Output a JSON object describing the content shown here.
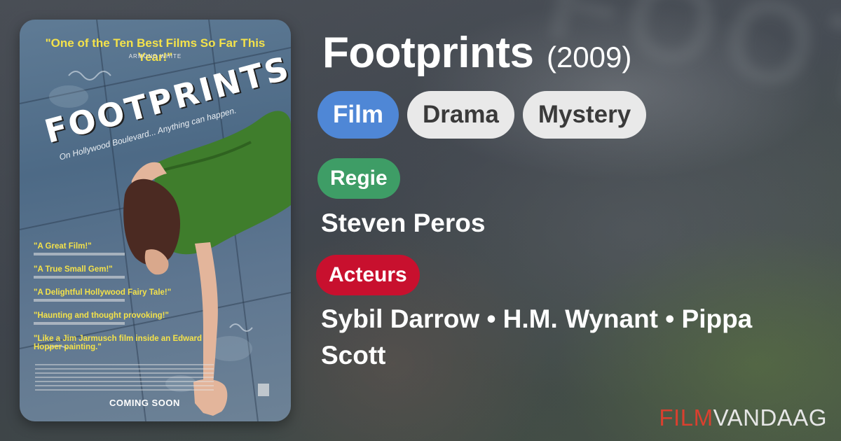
{
  "film": {
    "title": "Footprints",
    "year": "(2009)",
    "pills": [
      "Film",
      "Drama",
      "Mystery"
    ],
    "regie_label": "Regie",
    "director": "Steven Peros",
    "acteurs_label": "Acteurs",
    "actors": "Sybil Darrow • H.M. Wynant • Pippa Scott"
  },
  "poster": {
    "top_quote": "\"One of the Ten Best Films So Far This Year!\"",
    "top_quote_author": "ARMOND WHITE",
    "title": "FOOTPRINTS",
    "tagline": "On Hollywood Boulevard... Anything can happen.",
    "quotes": [
      "\"A Great Film!\"",
      "\"A True Small Gem!\"",
      "\"A Delightful Hollywood Fairy Tale!\"",
      "\"Haunting and thought provoking!\"",
      "\"Like a Jim Jarmusch film inside an Edward Hopper painting.\""
    ],
    "coming": "COMING SOON"
  },
  "brand": {
    "part1": "FILM",
    "part2": "VANDAAG"
  },
  "colors": {
    "film_pill": "#4f87d6",
    "regie": "#3e9d66",
    "acteurs": "#c8102e",
    "brand_red": "#d9402f"
  }
}
